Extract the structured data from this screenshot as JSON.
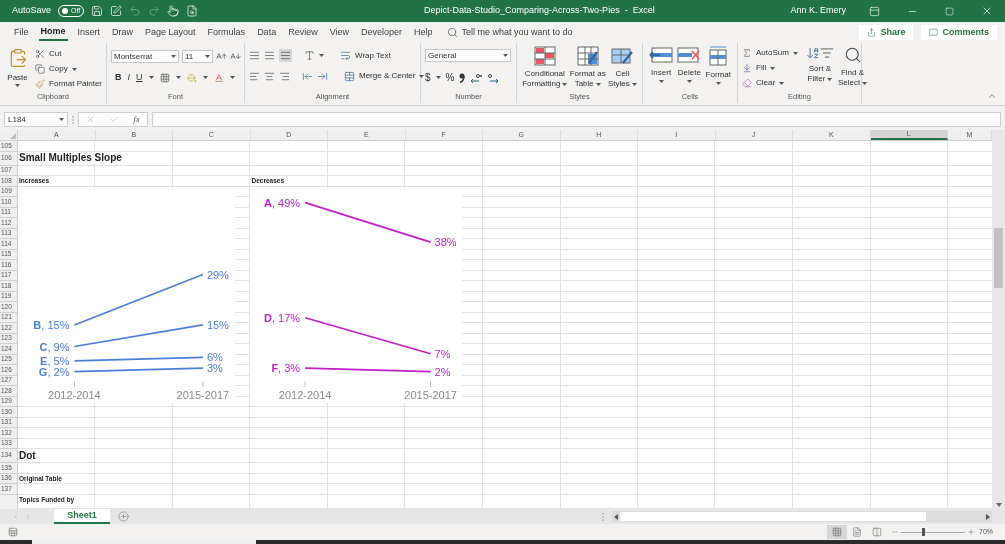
{
  "title_bar": {
    "autosave_label": "AutoSave",
    "autosave_toggle": "Off",
    "autosave_on": false,
    "title": "Depict-Data-Studio_Comparing-Across-Two-Pies  -  Excel",
    "user": "Ann K. Emery"
  },
  "menu_tabs": [
    {
      "label": "File",
      "selected": false
    },
    {
      "label": "Home",
      "selected": true
    },
    {
      "label": "Insert",
      "selected": false
    },
    {
      "label": "Draw",
      "selected": false
    },
    {
      "label": "Page Layout",
      "selected": false
    },
    {
      "label": "Formulas",
      "selected": false
    },
    {
      "label": "Data",
      "selected": false
    },
    {
      "label": "Review",
      "selected": false
    },
    {
      "label": "View",
      "selected": false
    },
    {
      "label": "Developer",
      "selected": false
    },
    {
      "label": "Help",
      "selected": false
    }
  ],
  "search": {
    "placeholder": "Tell me what you want to do"
  },
  "share_button": "Share",
  "comments_button": "Comments",
  "ribbon": {
    "clipboard": {
      "label": "Clipboard",
      "paste": "Paste",
      "cut": "Cut",
      "copy": "Copy",
      "format_painter": "Format Painter"
    },
    "font": {
      "label": "Font",
      "font_name": "Montserrat",
      "font_size": "11",
      "bold": "B",
      "italic": "I",
      "underline": "U"
    },
    "alignment": {
      "label": "Alignment",
      "wrap_text": "Wrap Text",
      "merge_center": "Merge & Center"
    },
    "number": {
      "label": "Number",
      "format": "General",
      "currency": "$",
      "percent": "%"
    },
    "styles": {
      "label": "Styles",
      "buttons": [
        {
          "kind": "conditional",
          "lines": [
            "Conditional",
            "Formatting"
          ]
        },
        {
          "kind": "table",
          "lines": [
            "Format as",
            "Table"
          ]
        },
        {
          "kind": "cell",
          "lines": [
            "Cell",
            "Styles"
          ]
        }
      ]
    },
    "cells": {
      "label": "Cells",
      "buttons": [
        {
          "kind": "insert",
          "label": "Insert"
        },
        {
          "kind": "delete",
          "label": "Delete"
        },
        {
          "kind": "format",
          "label": "Format"
        }
      ]
    },
    "editing": {
      "label": "Editing",
      "autosum": "AutoSum",
      "fill": "Fill",
      "clear": "Clear",
      "sort_filter": [
        "Sort &",
        "Filter"
      ],
      "find_select": [
        "Find &",
        "Select"
      ]
    }
  },
  "formula_bar": {
    "name_box": "L184",
    "function_label": "fx"
  },
  "columns": [
    {
      "label": "A",
      "selected": false
    },
    {
      "label": "B",
      "selected": false
    },
    {
      "label": "C",
      "selected": false
    },
    {
      "label": "D",
      "selected": false
    },
    {
      "label": "E",
      "selected": false
    },
    {
      "label": "F",
      "selected": false
    },
    {
      "label": "G",
      "selected": false
    },
    {
      "label": "H",
      "selected": false
    },
    {
      "label": "I",
      "selected": false
    },
    {
      "label": "J",
      "selected": false
    },
    {
      "label": "K",
      "selected": false
    },
    {
      "label": "L",
      "selected": true
    },
    {
      "label": "M",
      "selected": false
    }
  ],
  "rows": [
    {
      "header": "105",
      "kind": "plain"
    },
    {
      "header": "106",
      "kind": "title",
      "a": "Small Multiples Slope"
    },
    {
      "header": "107",
      "kind": "plain"
    },
    {
      "header": "108",
      "kind": "heading",
      "a": "Increases",
      "d": "Decreases"
    },
    {
      "header": "109",
      "kind": "plain"
    },
    {
      "header": "110",
      "kind": "plain"
    },
    {
      "header": "111",
      "kind": "plain"
    },
    {
      "header": "112",
      "kind": "plain"
    },
    {
      "header": "113",
      "kind": "plain"
    },
    {
      "header": "114",
      "kind": "plain"
    },
    {
      "header": "115",
      "kind": "plain"
    },
    {
      "header": "116",
      "kind": "plain"
    },
    {
      "header": "117",
      "kind": "plain"
    },
    {
      "header": "118",
      "kind": "plain"
    },
    {
      "header": "119",
      "kind": "plain"
    },
    {
      "header": "120",
      "kind": "plain"
    },
    {
      "header": "121",
      "kind": "plain"
    },
    {
      "header": "122",
      "kind": "plain"
    },
    {
      "header": "123",
      "kind": "plain"
    },
    {
      "header": "124",
      "kind": "plain"
    },
    {
      "header": "125",
      "kind": "plain"
    },
    {
      "header": "126",
      "kind": "plain"
    },
    {
      "header": "127",
      "kind": "plain"
    },
    {
      "header": "128",
      "kind": "plain"
    },
    {
      "header": "129",
      "kind": "plain"
    },
    {
      "header": "130",
      "kind": "plain"
    },
    {
      "header": "131",
      "kind": "plain"
    },
    {
      "header": "132",
      "kind": "plain"
    },
    {
      "header": "133",
      "kind": "plain"
    },
    {
      "header": "134",
      "kind": "title",
      "a": "Dot"
    },
    {
      "header": "135",
      "kind": "plain"
    },
    {
      "header": "136",
      "kind": "heading",
      "a": "Original Table"
    },
    {
      "header": "137",
      "kind": "plain"
    },
    {
      "kind": "heading",
      "a": "Topics Funded by"
    }
  ],
  "charts": [
    {
      "chart_data": {
        "type": "line",
        "categories": [
          "2012-2014",
          "2015-2017"
        ],
        "data_labels": true,
        "series": [
          {
            "color": "#4a7fdc",
            "values": [
              15,
              29
            ],
            "value_labels": [
              "**B**, 15%",
              "29%"
            ]
          },
          {
            "color": "#4a7fdc",
            "values": [
              9,
              15
            ],
            "value_labels": [
              "**C**, 9%",
              "15%"
            ]
          },
          {
            "color": "#4a7fdc",
            "values": [
              5,
              6
            ],
            "value_labels": [
              "**E**, 5%",
              "6%"
            ]
          },
          {
            "color": "#4a7fdc",
            "values": [
              2,
              3
            ],
            "value_labels": [
              "**G**, 2%",
              "3%"
            ]
          }
        ]
      }
    },
    {
      "chart_data": {
        "type": "line",
        "categories": [
          "2012-2014",
          "2015-2017"
        ],
        "data_labels": true,
        "series": [
          {
            "color": "#c21fc8",
            "values": [
              49,
              38
            ],
            "value_labels": [
              "**A**, 49%",
              "38%"
            ]
          },
          {
            "color": "#c21fc8",
            "values": [
              17,
              7
            ],
            "value_labels": [
              "**D**, 17%",
              "7%"
            ]
          },
          {
            "color": "#c21fc8",
            "values": [
              3,
              2
            ],
            "value_labels": [
              "**F**, 3%",
              "2%"
            ]
          }
        ]
      }
    }
  ],
  "sheet_tabs": [
    {
      "label": "Sheet1",
      "selected": true
    }
  ],
  "status_bar": {
    "views": [
      {
        "kind": "normal",
        "selected": true
      },
      {
        "kind": "page_layout",
        "selected": false
      },
      {
        "kind": "page_break",
        "selected": false
      }
    ],
    "zoom": {
      "level": 0.35,
      "reading": "70%"
    }
  }
}
